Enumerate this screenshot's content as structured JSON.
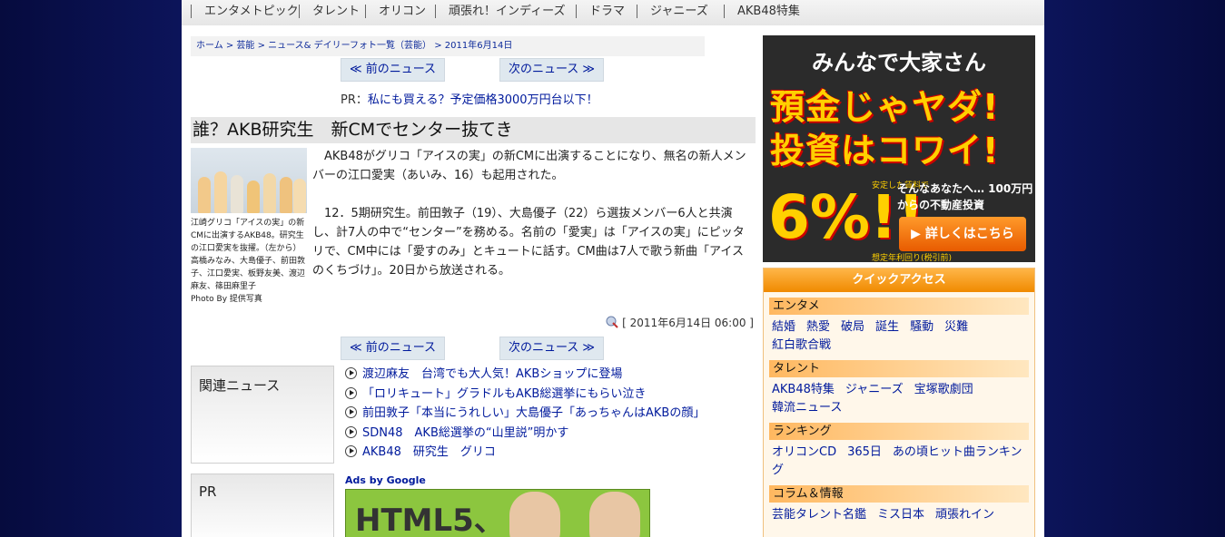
{
  "topnav": [
    "エンタメトピック",
    "タレント",
    "オリコン",
    "頑張れ！インディーズ",
    "ドラマ",
    "ジャニーズ",
    "AKB48特集"
  ],
  "breadcrumb": "ホーム > 芸能 > ニュース& デイリーフォト一覧（芸能） > 2011年6月14日",
  "nav": {
    "prev": "≪ 前のニュース",
    "next": "次のニュース ≫"
  },
  "pr": {
    "label": "PR：",
    "link": "私にも買える？予定価格3000万円台以下！"
  },
  "article": {
    "title": "誰？AKB研究生　新CMでセンター抜てき",
    "caption": "江崎グリコ「アイスの実」の新CMに出演するAKB48。研究生の江口愛実を抜擢。（左から）高橋みなみ、大島優子、前田敦子、江口愛実、板野友美、渡辺麻友、篠田麻里子",
    "credit": "Photo By 提供写真",
    "para1": "　AKB48がグリコ「アイスの実」の新CMに出演することになり、無名の新人メンバーの江口愛実（あいみ、16）も起用された。",
    "para2": "　12．5期研究生。前田敦子（19）、大島優子（22）ら選抜メンバー6人と共演し、計7人の中で“センター”を務める。名前の「愛実」は「アイスの実」にピッタリで、CM中には「愛すのみ」とキュートに話す。CM曲は7人で歌う新曲「アイスのくちづけ」。20日から放送される。",
    "date": "[ 2011年6月14日 06:00 ]"
  },
  "related": {
    "heading": "関連ニュース",
    "items": [
      "渡辺麻友　台湾でも大人気！AKBショップに登場",
      "「ロリキュート」グラドルもAKB総選挙にもらい泣き",
      "前田敦子「本当にうれしい」大島優子「あっちゃんはAKBの顔」",
      "SDN48　AKB総選挙の“山里説”明かす",
      "AKB48　研究生　グリコ"
    ]
  },
  "pr_section": {
    "heading": "PR",
    "ads_label": "Ads by Google",
    "ad_text": "HTML5、"
  },
  "banner": {
    "line1": "みんなで大家さん",
    "line2": "預金じゃヤダ!",
    "line3": "投資はコワイ!",
    "small1": "安定した賃料で",
    "pct": "6%!!",
    "small2": "想定年利回り(税引前)",
    "sub": "そんなあなたへ… 100万円からの不動産投資",
    "cta": "▶ 詳しくはこちら"
  },
  "quick": {
    "title": "クイックアクセス",
    "sections": [
      {
        "name": "エンタメ",
        "links": [
          "結婚",
          "熱愛",
          "破局",
          "誕生",
          "騒動",
          "災難",
          "紅白歌合戦"
        ]
      },
      {
        "name": "タレント",
        "links": [
          "AKB48特集",
          "ジャニーズ",
          "宝塚歌劇団",
          "韓流ニュース"
        ]
      },
      {
        "name": "ランキング",
        "links": [
          "オリコンCD",
          "365日",
          "あの頃ヒット曲ランキング"
        ]
      },
      {
        "name": "コラム＆情報",
        "links": [
          "芸能タレント名鑑",
          "ミス日本",
          "頑張れイン"
        ]
      }
    ]
  },
  "colors": {
    "background": "#0c145a",
    "link": "#001a9c",
    "quick_access": "#f08a00"
  }
}
